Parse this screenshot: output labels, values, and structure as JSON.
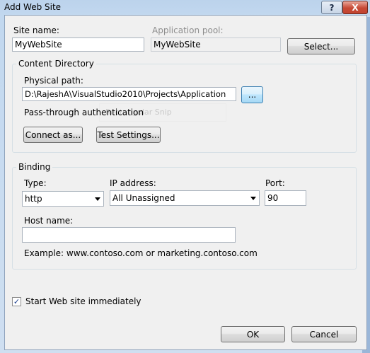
{
  "window": {
    "title": "Add Web Site",
    "help_label": "?",
    "close_label": "X"
  },
  "site": {
    "name_label": "Site name:",
    "name_value": "MyWebSite",
    "pool_label": "Application pool:",
    "pool_value": "MyWebSite",
    "select_button": "Select..."
  },
  "content_directory": {
    "title": "Content Directory",
    "physical_path_label": "Physical path:",
    "physical_path_value": "D:\\RajeshA\\VisualStudio2010\\Projects\\Application",
    "browse_button": "...",
    "passthrough_label": "Pass-through authentication",
    "connect_as_button": "Connect as...",
    "test_settings_button": "Test Settings...",
    "overlay_text": "Rectangular Snip"
  },
  "binding": {
    "title": "Binding",
    "type_label": "Type:",
    "type_value": "http",
    "ip_label": "IP address:",
    "ip_value": "All Unassigned",
    "port_label": "Port:",
    "port_value": "90",
    "host_label": "Host name:",
    "host_value": "",
    "example_text": "Example: www.contoso.com or marketing.contoso.com"
  },
  "start": {
    "checked": true,
    "check_glyph": "✓",
    "label": "Start Web site immediately"
  },
  "footer": {
    "ok_button": "OK",
    "cancel_button": "Cancel"
  }
}
